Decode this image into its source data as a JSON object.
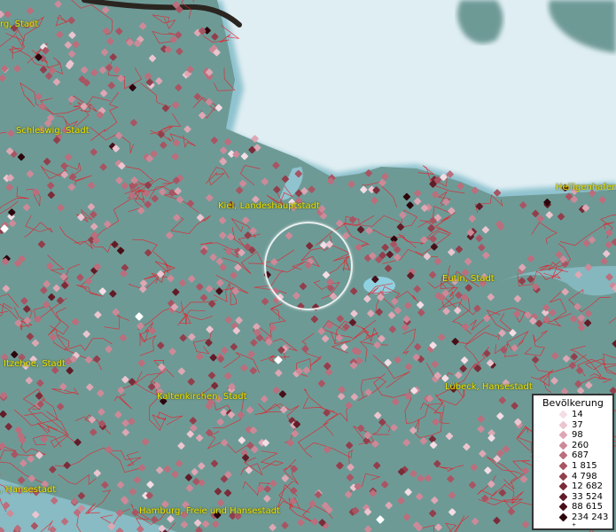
{
  "legend": {
    "title": "Bevölkerung",
    "items": [
      {
        "label": "14",
        "color": "#f4dde4"
      },
      {
        "label": "37",
        "color": "#ebc5cf"
      },
      {
        "label": "98",
        "color": "#dda7b3"
      },
      {
        "label": "260",
        "color": "#cc8a98"
      },
      {
        "label": "687",
        "color": "#bb6e7c"
      },
      {
        "label": "1 815",
        "color": "#a85563"
      },
      {
        "label": "4 798",
        "color": "#923f4c"
      },
      {
        "label": "12 682",
        "color": "#7a2c38"
      },
      {
        "label": "33 524",
        "color": "#611c27"
      },
      {
        "label": "88 615",
        "color": "#471019"
      },
      {
        "label": "234 243 ⁺",
        "color": "#2c060c"
      }
    ]
  },
  "places": [
    {
      "id": "rg-stadt",
      "label": "rg, Stadt"
    },
    {
      "id": "schleswig",
      "label": "Schleswig, Stadt"
    },
    {
      "id": "kiel",
      "label": "Kiel, Landeshauptstadt"
    },
    {
      "id": "heiligenhafen",
      "label": "Heiligenhafen,"
    },
    {
      "id": "eutin",
      "label": "Eutin, Stadt"
    },
    {
      "id": "itzehoe",
      "label": "Itzehoe, Stadt"
    },
    {
      "id": "kaltenkirchen",
      "label": "Kaltenkirchen, Stadt"
    },
    {
      "id": "luebeck",
      "label": "Lübeck, Hansestadt"
    },
    {
      "id": "hansestadt",
      "label": ", Hansestadt"
    },
    {
      "id": "hamburg",
      "label": "Hamburg, Freie und Hansestadt"
    }
  ],
  "colors": {
    "water": "#dfeef3",
    "land": "#6e9a96",
    "boundary": "#e8202a",
    "label": "#f2e600"
  }
}
